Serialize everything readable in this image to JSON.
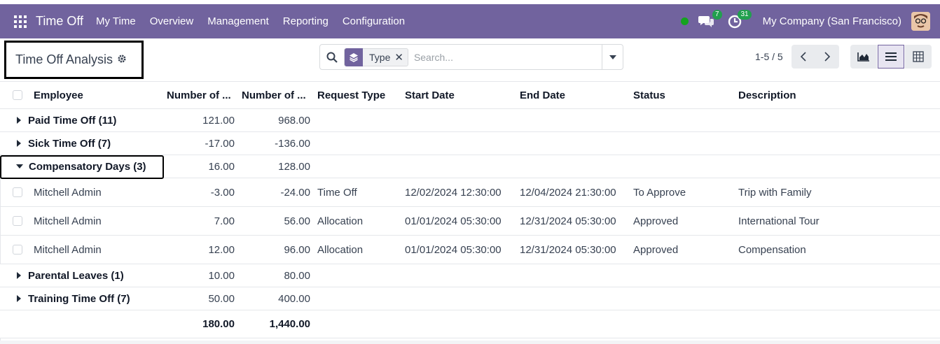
{
  "navbar": {
    "app_name": "Time Off",
    "menu": [
      "My Time",
      "Overview",
      "Management",
      "Reporting",
      "Configuration"
    ],
    "messages_count": "7",
    "activities_count": "31",
    "company": "My Company (San Francisco)"
  },
  "control": {
    "title": "Time Off Analysis",
    "facet_label": "Type",
    "search_placeholder": "Search...",
    "pager": "1-5 / 5"
  },
  "table": {
    "columns": [
      "Employee",
      "Number of ...",
      "Number of ...",
      "Request Type",
      "Start Date",
      "End Date",
      "Status",
      "Description"
    ],
    "groups": [
      {
        "label": "Paid Time Off (11)",
        "days": "121.00",
        "hours": "968.00",
        "expanded": false
      },
      {
        "label": "Sick Time Off (7)",
        "days": "-17.00",
        "hours": "-136.00",
        "expanded": false
      },
      {
        "label": "Compensatory Days (3)",
        "days": "16.00",
        "hours": "128.00",
        "expanded": true
      }
    ],
    "records": [
      {
        "employee": "Mitchell Admin",
        "days": "-3.00",
        "hours": "-24.00",
        "type": "Time Off",
        "start": "12/02/2024 12:30:00",
        "end": "12/04/2024 21:30:00",
        "status": "To Approve",
        "description": "Trip with Family"
      },
      {
        "employee": "Mitchell Admin",
        "days": "7.00",
        "hours": "56.00",
        "type": "Allocation",
        "start": "01/01/2024 05:30:00",
        "end": "12/31/2024 05:30:00",
        "status": "Approved",
        "description": "International Tour"
      },
      {
        "employee": "Mitchell Admin",
        "days": "12.00",
        "hours": "96.00",
        "type": "Allocation",
        "start": "01/01/2024 05:30:00",
        "end": "12/31/2024 05:30:00",
        "status": "Approved",
        "description": "Compensation"
      }
    ],
    "groups_after": [
      {
        "label": "Parental Leaves (1)",
        "days": "10.00",
        "hours": "80.00",
        "expanded": false
      },
      {
        "label": "Training Time Off (7)",
        "days": "50.00",
        "hours": "400.00",
        "expanded": false
      }
    ],
    "totals": {
      "days": "180.00",
      "hours": "1,440.00"
    }
  },
  "colors": {
    "brand": "#71639e",
    "online": "#14a31e",
    "badge": "#21a04e"
  }
}
